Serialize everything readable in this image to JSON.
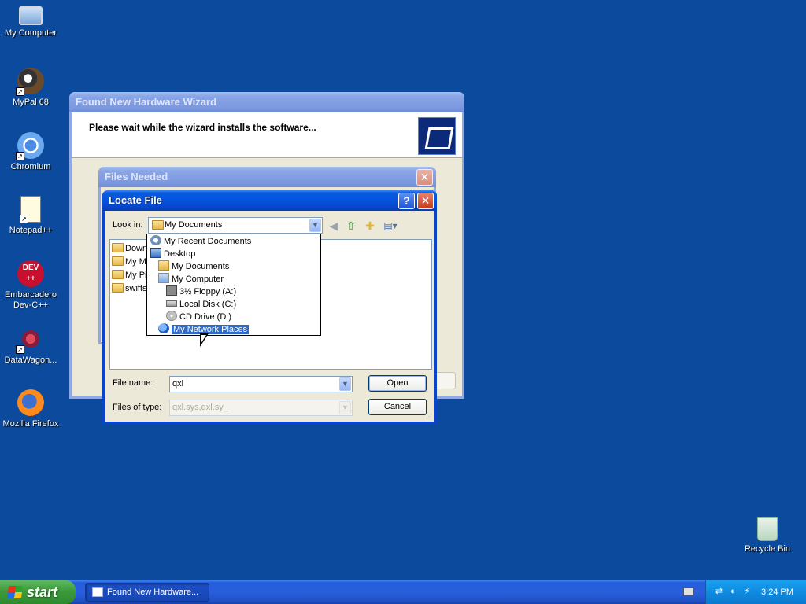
{
  "desktop": {
    "icons": [
      {
        "label": "My Computer",
        "icon": "computer-icon"
      },
      {
        "label": "MyPal 68",
        "icon": "mypal-icon"
      },
      {
        "label": "Chromium",
        "icon": "chromium-icon"
      },
      {
        "label": "Notepad++",
        "icon": "notepadpp-icon"
      },
      {
        "label": "Embarcadero Dev-C++",
        "icon": "devcpp-icon"
      },
      {
        "label": "DataWagon...",
        "icon": "datawagon-icon"
      },
      {
        "label": "Mozilla Firefox",
        "icon": "firefox-icon"
      },
      {
        "label": "Recycle Bin",
        "icon": "recycle-bin-icon"
      }
    ],
    "devcpp_icon_text": "DEV\n++"
  },
  "wizard": {
    "title": "Found New Hardware Wizard",
    "message": "Please wait while the wizard installs the software..."
  },
  "files_needed": {
    "title": "Files Needed",
    "close": "✕"
  },
  "locate_file": {
    "title": "Locate File",
    "help": "?",
    "close": "✕",
    "look_in_label": "Look in:",
    "look_in_value": "My Documents",
    "files": [
      "Down",
      "My Mu",
      "My Pic",
      "swifts"
    ],
    "file_name_label": "File name:",
    "file_name_value": "qxl",
    "files_of_type_label": "Files of type:",
    "files_of_type_value": "qxl.sys,qxl.sy_",
    "open_label": "Open",
    "cancel_label": "Cancel"
  },
  "look_in_dropdown": {
    "items": [
      {
        "label": "My Recent Documents",
        "icon": "recent-documents-icon"
      },
      {
        "label": "Desktop",
        "icon": "desktop-icon"
      },
      {
        "label": "My Documents",
        "icon": "my-documents-icon"
      },
      {
        "label": "My Computer",
        "icon": "my-computer-icon"
      },
      {
        "label": "3½ Floppy (A:)",
        "icon": "floppy-drive-icon"
      },
      {
        "label": "Local Disk (C:)",
        "icon": "local-disk-icon"
      },
      {
        "label": "CD Drive (D:)",
        "icon": "cd-drive-icon"
      },
      {
        "label": "My Network Places",
        "icon": "network-places-icon",
        "selected": true
      }
    ]
  },
  "taskbar": {
    "start_label": "start",
    "task_label": "Found New Hardware...",
    "clock": "3:24 PM"
  },
  "colors": {
    "desktop": "#0b4a9c",
    "title_active": "#0553dd",
    "selection": "#316ac5",
    "start_button": "#3c9a3c"
  }
}
